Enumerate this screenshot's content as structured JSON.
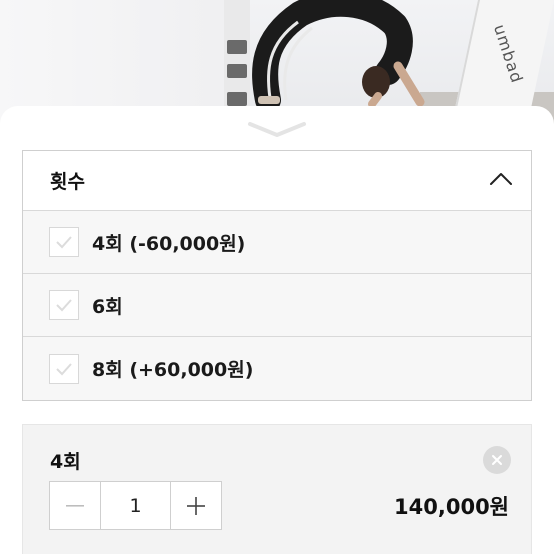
{
  "photo": {
    "sign_text": "umbad"
  },
  "options": {
    "title": "횟수",
    "items": [
      {
        "label": "4회 (-60,000원)"
      },
      {
        "label": "6회"
      },
      {
        "label": "8회 (+60,000원)"
      }
    ]
  },
  "selected": {
    "name": "4회",
    "quantity": "1",
    "price": "140,000원"
  },
  "icons": {
    "sheet_handle": "chevron-down-icon",
    "collapse": "chevron-up-icon",
    "check": "check-icon",
    "remove": "close-icon",
    "decrease": "minus-icon",
    "increase": "plus-icon"
  }
}
